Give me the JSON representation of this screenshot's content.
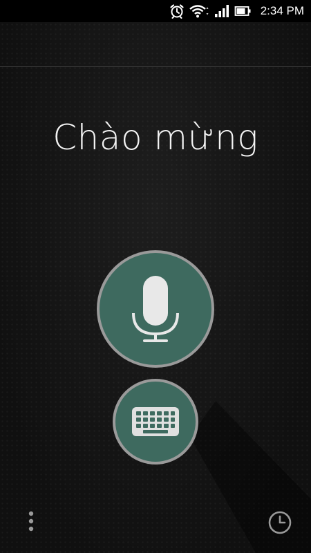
{
  "status_bar": {
    "time": "2:34 PM",
    "icons": [
      "alarm-icon",
      "wifi-icon",
      "signal-icon",
      "battery-icon"
    ]
  },
  "main": {
    "title": "Chào mừng",
    "mic_button_icon": "microphone-icon",
    "keyboard_button_icon": "keyboard-icon",
    "menu_icon": "more-vertical-icon",
    "history_icon": "clock-icon"
  },
  "colors": {
    "button_fill": "#3e6a5f",
    "button_ring": "#9a9a9a",
    "background": "#181818",
    "status_bar": "#000000"
  }
}
